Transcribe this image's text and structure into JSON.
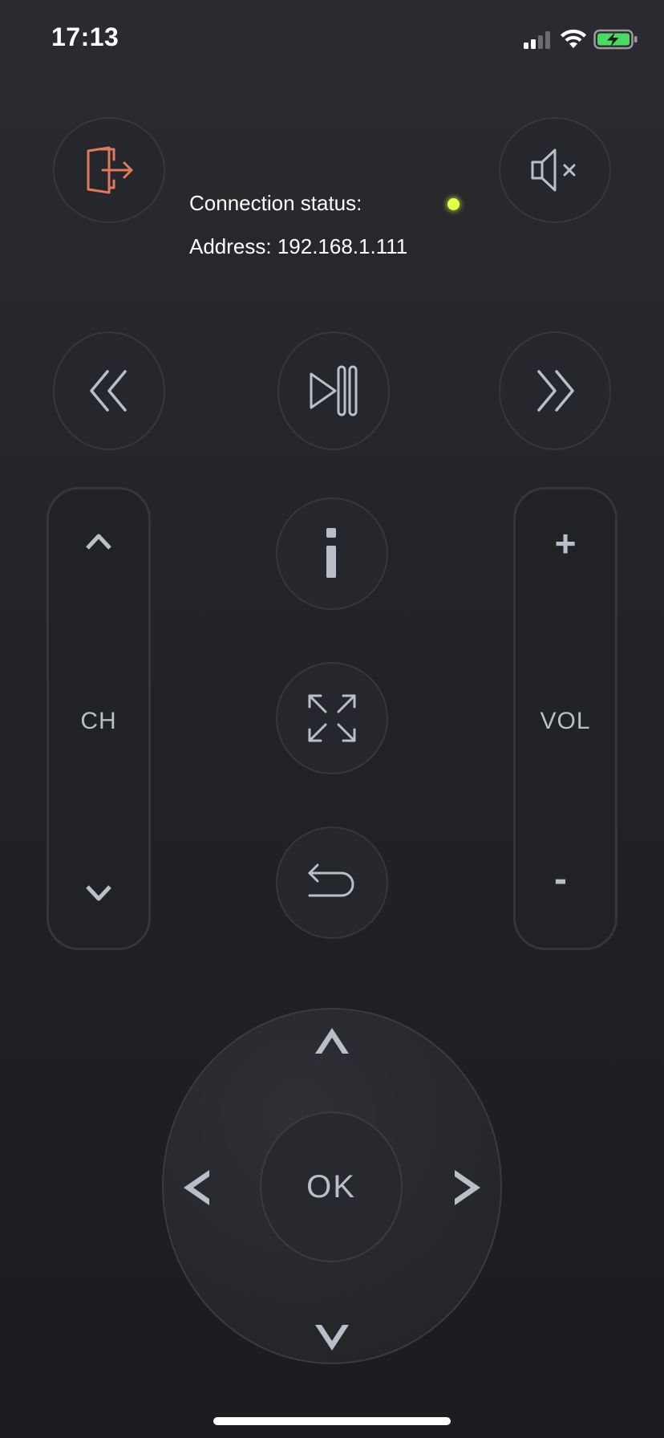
{
  "status_bar": {
    "time": "17:13",
    "signal_icon": "cellular-signal-icon",
    "wifi_icon": "wifi-icon",
    "battery_icon": "battery-charging-icon",
    "battery_color": "#4cd964"
  },
  "header": {
    "exit_icon": "exit-door-icon",
    "mute_icon": "speaker-mute-icon",
    "connection_status_label": "Connection status:",
    "connection_indicator_color": "#e4ff48",
    "address_label": "Address: 192.168.1.111"
  },
  "media": {
    "rewind_icon": "rewind-icon",
    "play_pause_icon": "play-pause-icon",
    "fast_forward_icon": "fast-forward-icon"
  },
  "channel": {
    "label": "CH",
    "up_icon": "chevron-up-icon",
    "down_icon": "chevron-down-icon"
  },
  "volume": {
    "label": "VOL",
    "up_symbol": "+",
    "down_symbol": "-"
  },
  "center": {
    "info_icon": "info-icon",
    "fullscreen_icon": "fullscreen-icon",
    "back_icon": "back-arrow-icon"
  },
  "dpad": {
    "ok_label": "OK",
    "up_icon": "arrow-up-icon",
    "down_icon": "arrow-down-icon",
    "left_icon": "arrow-left-icon",
    "right_icon": "arrow-right-icon"
  },
  "colors": {
    "accent_exit": "#e07a5f",
    "icon_color": "#b8bfc8",
    "background": "#242529"
  }
}
